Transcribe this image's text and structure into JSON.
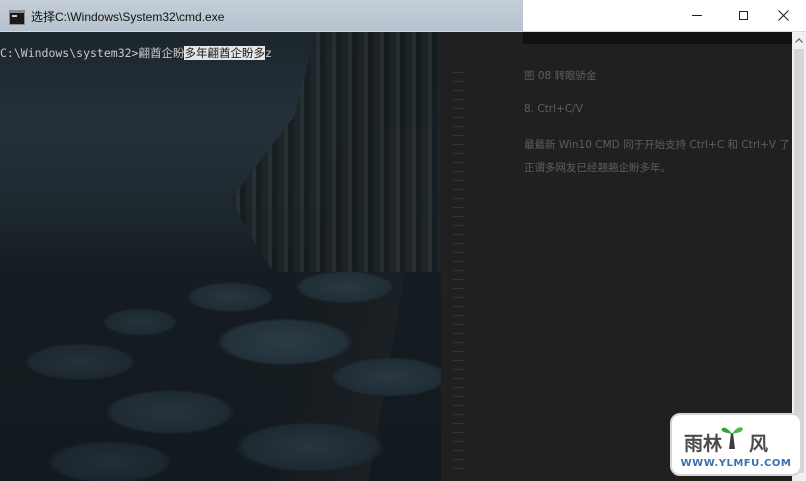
{
  "window": {
    "title": "选择C:\\Windows\\System32\\cmd.exe",
    "controls": {
      "minimize": "minimize",
      "maximize": "maximize",
      "close": "close"
    }
  },
  "console": {
    "prompt": "C:\\Windows\\system32>",
    "typed_text": "翩酋企盼",
    "selected_text": "多年翩酋企盼多",
    "cursor_char": "z"
  },
  "background_panel": {
    "lines": [
      "图 08  转眼骄金",
      "8.    Ctrl+C/V",
      "最最新 Win10 CMD 同于开始支持 Ctrl+C 和 Ctrl+V 了",
      "正谓多网友已经翘翘企盼多年。"
    ]
  },
  "watermark": {
    "logo_text": "雨林木风",
    "url": "WWW.YLMFU.COM"
  },
  "colors": {
    "title_strip": "#bcc7d2",
    "console_text": "#c8c8c8",
    "selection_bg": "#e6e6e6",
    "watermark_text": "#4b4b4b",
    "watermark_url": "#3a6fb0",
    "watermark_leaf": "#37a03a"
  },
  "icons": [
    "cmd-app-icon",
    "minimize-icon",
    "maximize-icon",
    "close-icon",
    "scroll-up-arrow-icon",
    "tree-logo-icon"
  ]
}
